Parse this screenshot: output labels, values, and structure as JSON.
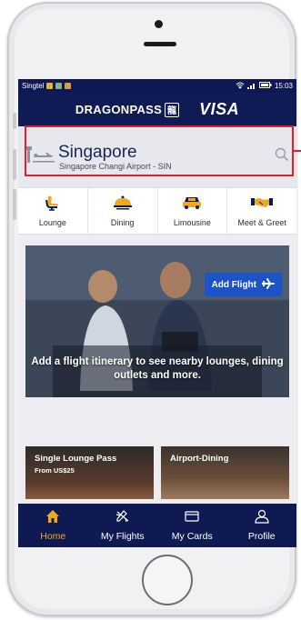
{
  "status": {
    "carrier": "Singtel",
    "time": "15:03"
  },
  "brand": {
    "name": "DRAGONPASS",
    "badge_glyph": "龍",
    "partner": "VISA"
  },
  "location": {
    "city": "Singapore",
    "airport": "Singapore Changi Airport - SIN"
  },
  "categories": [
    {
      "label": "Lounge",
      "icon": "lounge-chair-icon"
    },
    {
      "label": "Dining",
      "icon": "dining-cloche-icon"
    },
    {
      "label": "Limousine",
      "icon": "limousine-car-icon"
    },
    {
      "label": "Meet & Greet",
      "icon": "handshake-icon"
    }
  ],
  "promo": {
    "button_label": "Add Flight",
    "message": "Add a flight itinerary to see nearby lounges, dining outlets and more."
  },
  "cards": [
    {
      "title": "Single Lounge Pass",
      "subtitle": "From US$25"
    },
    {
      "title": "Airport-Dining",
      "subtitle": ""
    }
  ],
  "nav": [
    {
      "label": "Home",
      "icon": "home-icon",
      "active": true
    },
    {
      "label": "My Flights",
      "icon": "plane-icon",
      "active": false
    },
    {
      "label": "My Cards",
      "icon": "card-icon",
      "active": false
    },
    {
      "label": "Profile",
      "icon": "profile-icon",
      "active": false
    }
  ],
  "colors": {
    "brand_navy": "#101b56",
    "accent_blue": "#1c53c9",
    "active_orange": "#f0a91e",
    "highlight_red": "#e0202a"
  }
}
